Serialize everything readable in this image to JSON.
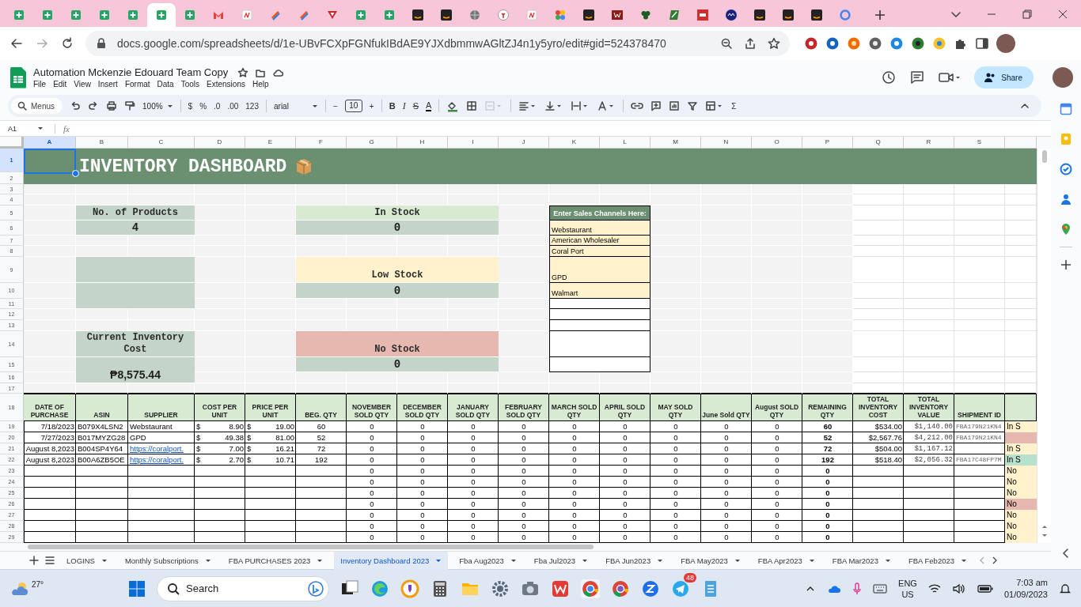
{
  "browser": {
    "tabs": [
      {
        "kind": "sheets",
        "selected": false
      },
      {
        "kind": "sheets",
        "selected": false
      },
      {
        "kind": "sheets",
        "selected": false
      },
      {
        "kind": "sheets",
        "selected": false
      },
      {
        "kind": "sheets",
        "selected": false
      },
      {
        "kind": "sheets",
        "selected": true
      },
      {
        "kind": "sheets",
        "selected": false
      },
      {
        "kind": "gmail",
        "selected": false
      },
      {
        "kind": "photo",
        "selected": false
      },
      {
        "kind": "stack",
        "selected": false
      },
      {
        "kind": "stack",
        "selected": false
      },
      {
        "kind": "flag",
        "selected": false
      },
      {
        "kind": "sheets",
        "selected": false
      },
      {
        "kind": "sheets",
        "selected": false
      },
      {
        "kind": "amazon",
        "selected": false
      },
      {
        "kind": "amazon",
        "selected": false
      },
      {
        "kind": "globe",
        "selected": false
      },
      {
        "kind": "plant",
        "selected": false
      },
      {
        "kind": "photo",
        "selected": false
      },
      {
        "kind": "colors",
        "selected": false
      },
      {
        "kind": "amazon",
        "selected": false
      },
      {
        "kind": "wine",
        "selected": false
      },
      {
        "kind": "clover",
        "selected": false
      },
      {
        "kind": "note",
        "selected": false
      },
      {
        "kind": "big",
        "selected": false
      },
      {
        "kind": "av",
        "selected": false
      },
      {
        "kind": "amazon",
        "selected": false
      },
      {
        "kind": "amazon",
        "selected": false
      },
      {
        "kind": "amazon",
        "selected": false
      },
      {
        "kind": "google",
        "selected": false
      }
    ],
    "url": "docs.google.com/spreadsheets/d/1e-UBvFCXpFGNfukIBdAE9YJXdbmmwAGltZJ4n1y5yro/edit#gid=524378470"
  },
  "document": {
    "title": "Automation Mckenzie Edouard Team Copy",
    "menus": [
      "File",
      "Edit",
      "View",
      "Insert",
      "Format",
      "Data",
      "Tools",
      "Extensions",
      "Help"
    ],
    "share": "Share"
  },
  "toolbar": {
    "search": "Menus",
    "zoom": "100%",
    "format_items": [
      "$",
      "%",
      ".0",
      ".00",
      "123"
    ],
    "font": "arial",
    "minus": "−",
    "font_size": "10",
    "plus": "+",
    "styles": [
      "B",
      "I",
      "S",
      "A"
    ],
    "sum": "Σ"
  },
  "formula_bar": {
    "cell": "A1",
    "fx": "fx"
  },
  "sheet": {
    "columns": [
      {
        "label": "A",
        "selected": true
      },
      {
        "label": "B",
        "selected": false
      },
      {
        "label": "C",
        "selected": false
      },
      {
        "label": "D",
        "selected": false
      },
      {
        "label": "E",
        "selected": false
      },
      {
        "label": "F",
        "selected": false
      },
      {
        "label": "G",
        "selected": false
      },
      {
        "label": "H",
        "selected": false
      },
      {
        "label": "I",
        "selected": false
      },
      {
        "label": "J",
        "selected": false
      },
      {
        "label": "K",
        "selected": false
      },
      {
        "label": "L",
        "selected": false
      },
      {
        "label": "M",
        "selected": false
      },
      {
        "label": "N",
        "selected": false
      },
      {
        "label": "O",
        "selected": false
      },
      {
        "label": "P",
        "selected": false
      },
      {
        "label": "Q",
        "selected": false
      },
      {
        "label": "R",
        "selected": false
      },
      {
        "label": "S",
        "selected": false
      }
    ],
    "rows": [
      {
        "label": "1",
        "selected": true
      },
      {
        "label": "2",
        "selected": false
      },
      {
        "label": "3",
        "selected": false
      },
      {
        "label": "4",
        "selected": false
      },
      {
        "label": "5",
        "selected": false
      },
      {
        "label": "6",
        "selected": false
      },
      {
        "label": "7",
        "selected": false
      },
      {
        "label": "8",
        "selected": false
      },
      {
        "label": "9",
        "selected": false
      },
      {
        "label": "10",
        "selected": false
      },
      {
        "label": "11",
        "selected": false
      },
      {
        "label": "12",
        "selected": false
      },
      {
        "label": "13",
        "selected": false
      },
      {
        "label": "14",
        "selected": false
      },
      {
        "label": "15",
        "selected": false
      },
      {
        "label": "16",
        "selected": false
      },
      {
        "label": "17",
        "selected": false
      },
      {
        "label": "18",
        "selected": false
      },
      {
        "label": "19",
        "selected": false
      },
      {
        "label": "20",
        "selected": false
      },
      {
        "label": "21",
        "selected": false
      },
      {
        "label": "22",
        "selected": false
      },
      {
        "label": "23",
        "selected": false
      },
      {
        "label": "24",
        "selected": false
      },
      {
        "label": "25",
        "selected": false
      },
      {
        "label": "26",
        "selected": false
      },
      {
        "label": "27",
        "selected": false
      },
      {
        "label": "28",
        "selected": false
      },
      {
        "label": "29",
        "selected": false
      }
    ],
    "title": "INVENTORY DASHBOARD",
    "cards": [
      {
        "kind": "products",
        "label": "No. of Products",
        "value": "4",
        "color": "#c5d4c8"
      },
      {
        "kind": "cost",
        "label": "Current Inventory Cost",
        "value": "₱8,575.44",
        "color": "#c5d4c8"
      },
      {
        "kind": "in_stock",
        "label": "In Stock",
        "value": "0",
        "color": "#d9ead3"
      },
      {
        "kind": "low_stock",
        "label": "Low Stock",
        "value": "0",
        "color": "#fff2cc"
      },
      {
        "kind": "no_stock",
        "label": "No Stock",
        "value": "0",
        "color": "#e6b8af"
      }
    ],
    "sales_channels": {
      "header": "Enter Sales Channels Here:",
      "entries": [
        "Webstaurant",
        "American Wholesaler",
        "Coral Port",
        "GPD",
        "Walmart"
      ]
    },
    "table": {
      "headers": [
        "DATE OF PURCHASE",
        "ASIN",
        "SUPPLIER",
        "COST PER UNIT",
        "PRICE PER UNIT",
        "BEG. QTY",
        "NOVEMBER SOLD QTY",
        "DECEMBER SOLD QTY",
        "JANUARY SOLD QTY",
        "FEBRUARY SOLD QTY",
        "MARCH SOLD QTY",
        "APRIL SOLD QTY",
        "MAY SOLD QTY",
        "June Sold QTY",
        "August SOLD QTY",
        "REMAINING QTY",
        "TOTAL INVENTORY COST",
        "TOTAL INVENTORY VALUE",
        "SHIPMENT ID"
      ],
      "rows": [
        {
          "date": "7/18/2023",
          "asin": "B079X4LSN2",
          "supplier": "Webstaurant",
          "supplier_link": false,
          "cost": {
            "symbol": "$",
            "amount": "8.90"
          },
          "price": {
            "symbol": "$",
            "amount": "19.00"
          },
          "beg_qty": "60",
          "sold": [
            "0",
            "0",
            "0",
            "0",
            "0",
            "0",
            "0",
            "0",
            "0"
          ],
          "remaining": "60",
          "total_cost": "$534.00",
          "total_value": "$1,140.00",
          "shipment": "FBA179N21KN4",
          "status": {
            "text": "In S",
            "color": "#fff2cc"
          }
        },
        {
          "date": "7/27/2023",
          "asin": "B017MYZG28",
          "supplier": "GPD",
          "supplier_link": false,
          "cost": {
            "symbol": "$",
            "amount": "49.38"
          },
          "price": {
            "symbol": "$",
            "amount": "81.00"
          },
          "beg_qty": "52",
          "sold": [
            "0",
            "0",
            "0",
            "0",
            "0",
            "0",
            "0",
            "0",
            "0"
          ],
          "remaining": "52",
          "total_cost": "$2,567.76",
          "total_value": "$4,212.00",
          "shipment": "FBA179N21KN4",
          "status": {
            "color": "#e6b8af"
          }
        },
        {
          "date": "August 8,2023",
          "asin": "B004SP4Y64",
          "supplier": "https://coralport.",
          "supplier_link": true,
          "cost": {
            "symbol": "$",
            "amount": "7.00"
          },
          "price": {
            "symbol": "$",
            "amount": "16.21"
          },
          "beg_qty": "72",
          "sold": [
            "0",
            "0",
            "0",
            "0",
            "0",
            "0",
            "0",
            "0",
            "0"
          ],
          "remaining": "72",
          "total_cost": "$504.00",
          "total_value": "$1,167.12",
          "status": {
            "text": "In S",
            "color": "#fff2cc"
          }
        },
        {
          "date": "August 8,2023",
          "asin": "B00A6ZB5OE",
          "supplier": "https://coralport.",
          "supplier_link": true,
          "cost": {
            "symbol": "$",
            "amount": "2.70"
          },
          "price": {
            "symbol": "$",
            "amount": "10.71"
          },
          "beg_qty": "192",
          "sold": [
            "0",
            "0",
            "0",
            "0",
            "0",
            "0",
            "0",
            "0",
            "0"
          ],
          "remaining": "192",
          "total_cost": "$518.40",
          "total_value": "$2,056.32",
          "shipment": "FBA17C48FP7M",
          "status": {
            "text": "In S",
            "color": "#b7e1cd"
          }
        },
        {
          "sold": [
            "0",
            "0",
            "0",
            "0",
            "0",
            "0",
            "0",
            "0",
            "0"
          ],
          "remaining": "0",
          "status": {
            "text": "No",
            "color": "#fff2cc"
          }
        },
        {
          "sold": [
            "0",
            "0",
            "0",
            "0",
            "0",
            "0",
            "0",
            "0",
            "0"
          ],
          "remaining": "0",
          "status": {
            "text": "No",
            "color": "#fff2cc"
          }
        },
        {
          "sold": [
            "0",
            "0",
            "0",
            "0",
            "0",
            "0",
            "0",
            "0",
            "0"
          ],
          "remaining": "0",
          "status": {
            "text": "No",
            "color": "#fff2cc"
          }
        },
        {
          "sold": [
            "0",
            "0",
            "0",
            "0",
            "0",
            "0",
            "0",
            "0",
            "0"
          ],
          "remaining": "0",
          "status": {
            "text": "No",
            "color": "#e6b8af"
          }
        },
        {
          "sold": [
            "0",
            "0",
            "0",
            "0",
            "0",
            "0",
            "0",
            "0",
            "0"
          ],
          "remaining": "0",
          "status": {
            "text": "No",
            "color": "#fff2cc"
          }
        },
        {
          "sold": [
            "0",
            "0",
            "0",
            "0",
            "0",
            "0",
            "0",
            "0",
            "0"
          ],
          "remaining": "0",
          "status": {
            "text": "No",
            "color": "#fff2cc"
          }
        },
        {
          "sold": [
            "0",
            "0",
            "0",
            "0",
            "0",
            "0",
            "0",
            "0",
            "0"
          ],
          "remaining": "0",
          "status": {
            "text": "No",
            "color": "#fff2cc"
          }
        }
      ]
    }
  },
  "sheet_tabs": [
    {
      "label": "LOGINS",
      "selected": false
    },
    {
      "label": "Monthly Subscriptions",
      "selected": false
    },
    {
      "label": "FBA PURCHASES 2023",
      "selected": false
    },
    {
      "label": "Inventory Dashboard 2023",
      "selected": true
    },
    {
      "label": "Fba Aug2023",
      "selected": false
    },
    {
      "label": "Fba Jul2023",
      "selected": false
    },
    {
      "label": "FBA Jun2023",
      "selected": false
    },
    {
      "label": "FBA May2023",
      "selected": false
    },
    {
      "label": "FBA Apr2023",
      "selected": false
    },
    {
      "label": "FBA Mar2023",
      "selected": false
    },
    {
      "label": "FBA Feb2023",
      "selected": false
    }
  ],
  "taskbar": {
    "temperature": "27°",
    "search": "Search",
    "badge": "48",
    "language": "ENG",
    "region": "US",
    "time": "7:03 am",
    "date": "01/09/2023"
  }
}
